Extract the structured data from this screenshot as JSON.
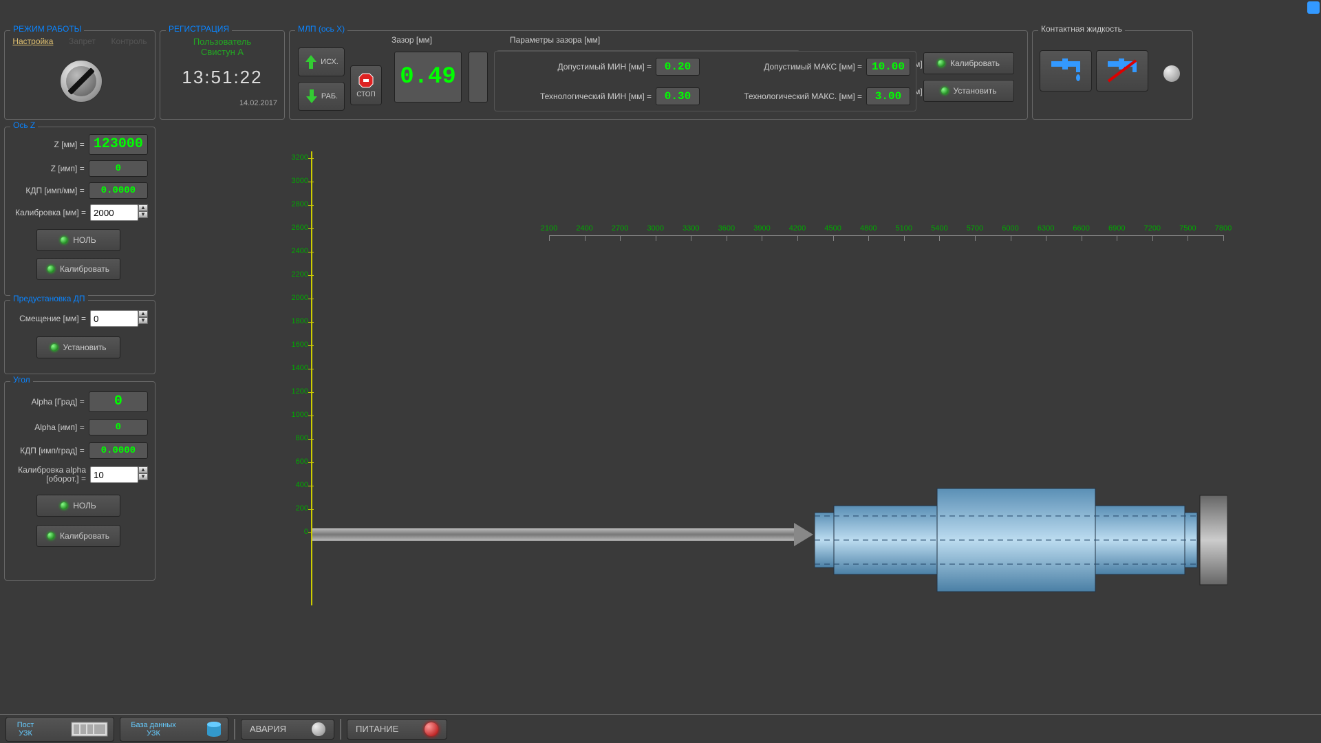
{
  "work_mode": {
    "legend": "РЕЖИМ РАБОТЫ",
    "tab_setup": "Настройка",
    "tab_lock": "Запрет",
    "tab_control": "Контроль"
  },
  "registration": {
    "legend": "РЕГИСТРАЦИЯ",
    "user_lbl": "Пользователь",
    "user_name": "Свистун А",
    "time": "13:51:22",
    "date": "14.02.2017"
  },
  "mlp": {
    "legend": "МЛП (ось X)",
    "btn_home": "ИСХ.",
    "btn_work": "РАБ.",
    "btn_stop": "СТОП",
    "gap_lbl": "Зазор [мм]",
    "gap_val": "0.49",
    "params_lbl": "Параметры зазора [мм]",
    "min_allow_lbl": "Допустимый МИН  [мм] =",
    "min_allow_val": "0.20",
    "min_tech_lbl": "Технологический МИН  [мм] =",
    "min_tech_val": "0.30",
    "max_allow_lbl": "Допустимый МАКС  [мм] =",
    "max_allow_val": "10.00",
    "max_tech_lbl": "Технологический МАКС. [мм] =",
    "max_tech_val": "3.00",
    "btn_calib": "Калибровать",
    "btn_set": "Установить",
    "liquid_lbl": "Контактная жидкость"
  },
  "axis_z": {
    "legend": "Ось Z",
    "z_mm_lbl": "Z [мм] =",
    "z_mm_val": "123000",
    "z_imp_lbl": "Z [имп] =",
    "z_imp_val": "0",
    "kdp_lbl": "КДП [имп/мм] =",
    "kdp_val": "0.0000",
    "calib_lbl": "Калибровка [мм] =",
    "calib_val": "2000",
    "btn_zero": "НОЛЬ",
    "btn_calib": "Калибровать"
  },
  "preset": {
    "legend": "Предустановка ДП",
    "offset_lbl": "Смещение [мм] =",
    "offset_val": "0",
    "btn_set": "Установить"
  },
  "angle": {
    "legend": "Угол",
    "a_deg_lbl": "Alpha [Град] =",
    "a_deg_val": "0",
    "a_imp_lbl": "Alpha [имп] =",
    "a_imp_val": "0",
    "kdp_lbl": "КДП [имп/град] =",
    "kdp_val": "0.0000",
    "calib_lbl": "Калибровка alpha [оборот.] =",
    "calib_val": "10",
    "btn_zero": "НОЛЬ",
    "btn_calib": "Калибровать"
  },
  "bottom": {
    "post": "Пост УЗК",
    "db": "База данных УЗК",
    "alarm": "АВАРИЯ",
    "power": "ПИТАНИЕ"
  },
  "chart_data": {
    "type": "line",
    "title": "",
    "xlabel": "",
    "ylabel": "",
    "x_ticks": [
      2100,
      2400,
      2700,
      3000,
      3300,
      3600,
      3900,
      4200,
      4500,
      4800,
      5100,
      5400,
      5700,
      6000,
      6300,
      6600,
      6900,
      7200,
      7500,
      7800
    ],
    "y_ticks": [
      0,
      200,
      400,
      600,
      800,
      1000,
      1200,
      1400,
      1600,
      1800,
      2000,
      2200,
      2400,
      2600,
      2800,
      3000,
      3200
    ],
    "ylim": [
      0,
      3200
    ],
    "series": []
  }
}
